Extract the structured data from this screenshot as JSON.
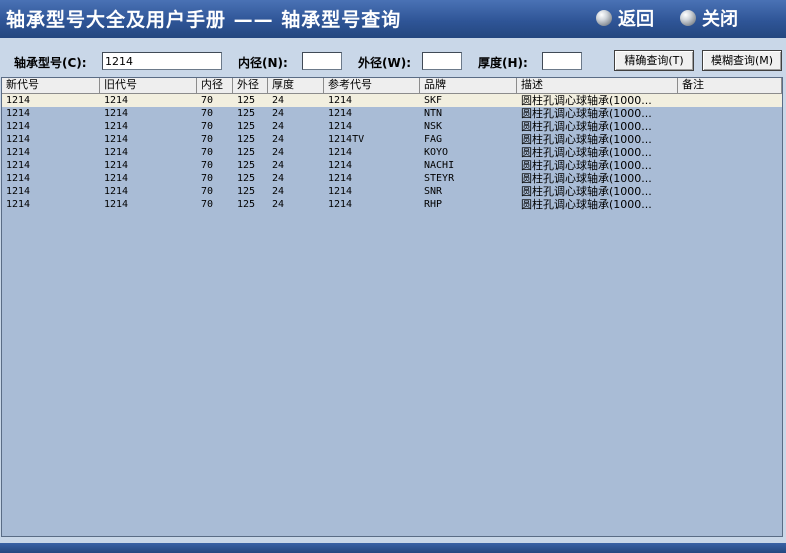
{
  "window": {
    "title": "轴承型号大全及用户手册 —— 轴承型号查询",
    "back_label": "返回",
    "close_label": "关闭"
  },
  "query": {
    "model_label": "轴承型号(C):",
    "model_value": "1214",
    "inner_label": "内径(N):",
    "inner_value": "",
    "outer_label": "外径(W):",
    "outer_value": "",
    "thick_label": "厚度(H):",
    "thick_value": "",
    "exact_button": "精确查询(T)",
    "fuzzy_button": "模糊查询(M)"
  },
  "table": {
    "columns": [
      "新代号",
      "旧代号",
      "内径",
      "外径",
      "厚度",
      "参考代号",
      "品牌",
      "描述",
      "备注"
    ],
    "rows": [
      [
        "1214",
        "1214",
        "70",
        "125",
        "24",
        "1214",
        "SKF",
        "圆柱孔调心球轴承(1000...",
        ""
      ],
      [
        "1214",
        "1214",
        "70",
        "125",
        "24",
        "1214",
        "NTN",
        "圆柱孔调心球轴承(1000...",
        ""
      ],
      [
        "1214",
        "1214",
        "70",
        "125",
        "24",
        "1214",
        "NSK",
        "圆柱孔调心球轴承(1000...",
        ""
      ],
      [
        "1214",
        "1214",
        "70",
        "125",
        "24",
        "1214TV",
        "FAG",
        "圆柱孔调心球轴承(1000...",
        ""
      ],
      [
        "1214",
        "1214",
        "70",
        "125",
        "24",
        "1214",
        "KOYO",
        "圆柱孔调心球轴承(1000...",
        ""
      ],
      [
        "1214",
        "1214",
        "70",
        "125",
        "24",
        "1214",
        "NACHI",
        "圆柱孔调心球轴承(1000...",
        ""
      ],
      [
        "1214",
        "1214",
        "70",
        "125",
        "24",
        "1214",
        "STEYR",
        "圆柱孔调心球轴承(1000...",
        ""
      ],
      [
        "1214",
        "1214",
        "70",
        "125",
        "24",
        "1214",
        "SNR",
        "圆柱孔调心球轴承(1000...",
        ""
      ],
      [
        "1214",
        "1214",
        "70",
        "125",
        "24",
        "1214",
        "RHP",
        "圆柱孔调心球轴承(1000...",
        ""
      ]
    ],
    "selected_row": 0
  }
}
